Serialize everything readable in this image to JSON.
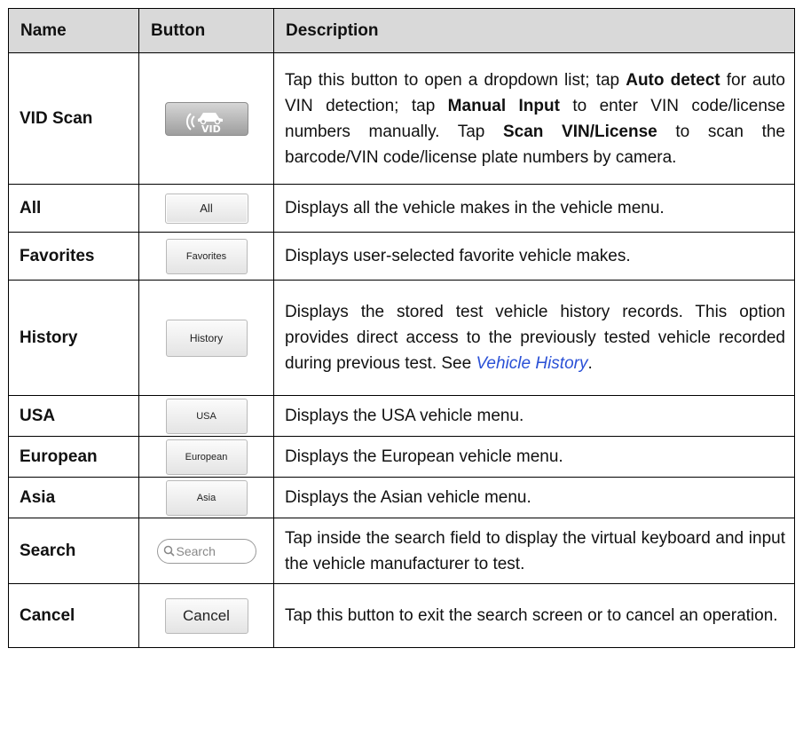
{
  "headers": {
    "name": "Name",
    "button": "Button",
    "description": "Description"
  },
  "rows": [
    {
      "name": "VID Scan",
      "button_icon": "vid-scan-icon",
      "description": [
        {
          "text": "Tap this button to open a dropdown list; tap "
        },
        {
          "text": "Auto detect",
          "bold": true
        },
        {
          "text": " for auto VIN detection; tap "
        },
        {
          "text": "Manual Input",
          "bold": true
        },
        {
          "text": " to enter VIN code/license numbers manually. Tap "
        },
        {
          "text": "Scan VIN/License",
          "bold": true
        },
        {
          "text": " to scan the barcode/VIN code/license plate numbers by camera."
        }
      ]
    },
    {
      "name": "All",
      "button_label": "All",
      "description": [
        {
          "text": "Displays all the vehicle makes in the vehicle menu."
        }
      ]
    },
    {
      "name": "Favorites",
      "button_label": "Favorites",
      "description": [
        {
          "text": "Displays user-selected favorite vehicle makes."
        }
      ]
    },
    {
      "name": "History",
      "button_label": "History",
      "description": [
        {
          "text": "Displays the stored test vehicle history records. This option provides direct access to the previously tested vehicle recorded during previous test. See "
        },
        {
          "text": "Vehicle History",
          "link": true
        },
        {
          "text": "."
        }
      ]
    },
    {
      "name": "USA",
      "button_label": "USA",
      "description": [
        {
          "text": "Displays the USA vehicle menu."
        }
      ]
    },
    {
      "name": "European",
      "button_label": "European",
      "description": [
        {
          "text": "Displays the European vehicle menu."
        }
      ]
    },
    {
      "name": "Asia",
      "button_label": "Asia",
      "description": [
        {
          "text": "Displays the Asian vehicle menu."
        }
      ]
    },
    {
      "name": "Search",
      "search_placeholder": "Search",
      "description": [
        {
          "text": "Tap inside the search field to display the virtual keyboard and input the vehicle manufacturer to test."
        }
      ]
    },
    {
      "name": "Cancel",
      "button_label": "Cancel",
      "description": [
        {
          "text": "Tap this button to exit the search screen or to cancel an operation."
        }
      ]
    }
  ],
  "colors": {
    "header_bg": "#d9d9d9",
    "link": "#2a50d6",
    "border": "#000000"
  }
}
